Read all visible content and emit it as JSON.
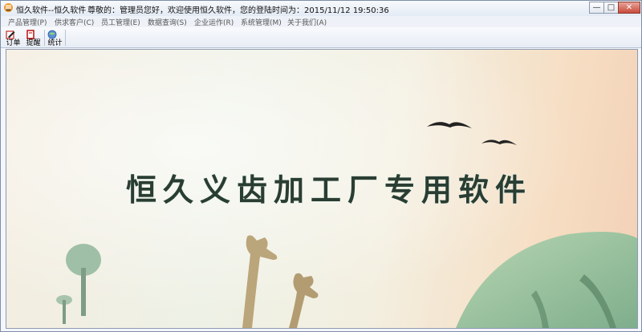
{
  "window": {
    "title": "恒久软件--恒久软件",
    "status": "尊敬的：管理员您好，欢迎使用恒久软件，您的登陆时间为：2015/11/12 19:50:36",
    "controls": {
      "minimize": "—",
      "maximize": "□",
      "close": "✕"
    }
  },
  "menu": [
    {
      "label": "产品管理(P)"
    },
    {
      "label": "供求客户(C)"
    },
    {
      "label": "员工管理(E)"
    },
    {
      "label": "数据查询(S)"
    },
    {
      "label": "企业运作(R)"
    },
    {
      "label": "系统管理(M)"
    },
    {
      "label": "关于我们(A)"
    }
  ],
  "toolbar": [
    {
      "label": "订单",
      "icon": "order-pen-icon"
    },
    {
      "label": "提醒",
      "icon": "reminder-note-icon"
    },
    {
      "label": "统计",
      "icon": "statistics-globe-icon"
    }
  ],
  "splash": {
    "headline": "恒久义齿加工厂专用软件"
  },
  "colors": {
    "headline": "#2a3d33",
    "headline_shadow": "#e8f2e6",
    "title_gradient_top": "#f7f9fc",
    "close_button": "#c94b3a",
    "hill": "#9dc5a4"
  }
}
